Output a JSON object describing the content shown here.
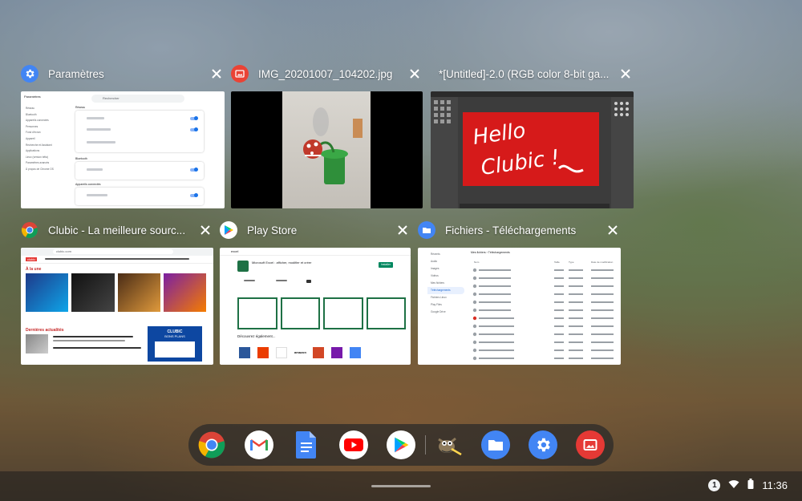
{
  "windows": [
    {
      "title": "Paramètres",
      "icon": "settings-icon",
      "color": "#4285f4"
    },
    {
      "title": "IMG_20201007_104202.jpg",
      "icon": "gallery-icon",
      "color": "#ea4335"
    },
    {
      "title": "*[Untitled]-2.0 (RGB color 8-bit ga...",
      "icon": "gimp-icon",
      "color": "#5f5f5f"
    },
    {
      "title": "Clubic - La meilleure sourc...",
      "icon": "chrome-icon",
      "color": "#ffffff"
    },
    {
      "title": "Play Store",
      "icon": "play-store-icon",
      "color": "#ffffff"
    },
    {
      "title": "Fichiers - Téléchargements",
      "icon": "files-icon",
      "color": "#4285f4"
    }
  ],
  "thumbs": {
    "settings": {
      "search_placeholder": "Rechercher",
      "section_network": "Réseau",
      "section_bluetooth": "Bluetooth",
      "section_devices": "Appareils connectés",
      "sidebar": [
        "Réseau",
        "Bluetooth",
        "Appareils connectés",
        "Personnes",
        "Fond d'écran",
        "Appareil",
        "Recherche et Assistant",
        "Applications",
        "Linux (version bêta)",
        "Paramètres avancés",
        "À propos de Chrome OS"
      ]
    },
    "gimp": {
      "canvas_text_1": "Hello",
      "canvas_text_2": "Clubic !"
    },
    "clubic": {
      "url": "clubic.com",
      "logo": "clubic",
      "section_a_la_une": "À la une",
      "section_dernieres": "Dernières actualités",
      "promo_title": "CLUBIC",
      "promo_sub": "BONS PLANS"
    },
    "playstore": {
      "search": "excel",
      "app_title": "Microsoft Excel : afficher, modifier et créer",
      "install": "Installer",
      "discover": "Découvrez également..."
    },
    "files": {
      "breadcrumb": "Mes fichiers  ›  Téléchargements",
      "col_name": "Nom",
      "col_size": "Taille",
      "col_type": "Type",
      "col_date": "Date de modification",
      "sidebar": [
        "Récents",
        "Audio",
        "Images",
        "Vidéos",
        "Mes fichiers",
        "Téléchargements",
        "Fichiers Linux",
        "Play Files",
        "Google Drive"
      ]
    }
  },
  "shelf": {
    "apps": [
      "chrome-icon",
      "gmail-icon",
      "docs-icon",
      "youtube-icon",
      "play-store-icon",
      "gimp-icon",
      "files-icon",
      "settings-icon",
      "gallery-icon"
    ]
  },
  "status": {
    "notifications": "1",
    "time": "11:36"
  }
}
